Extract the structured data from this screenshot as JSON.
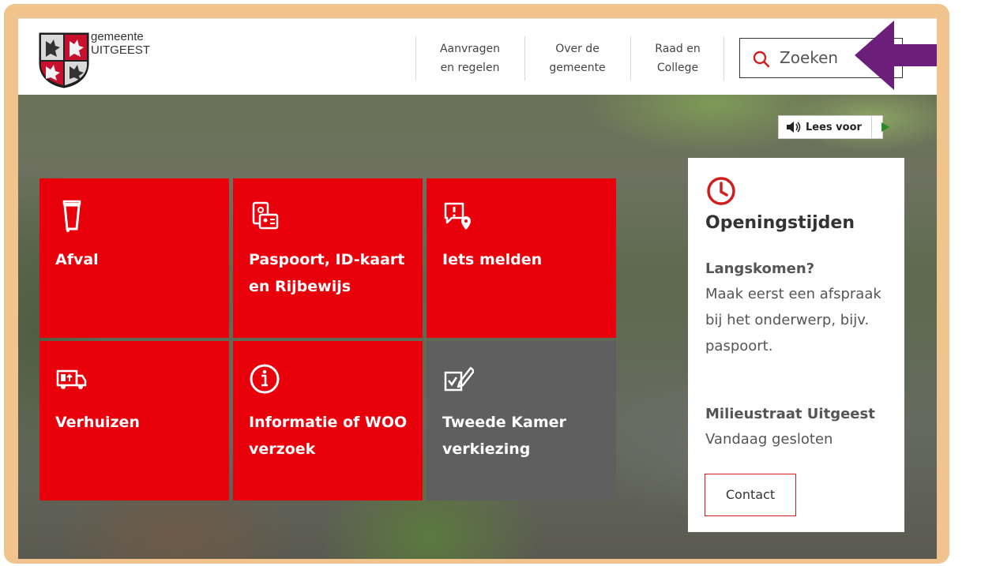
{
  "header": {
    "logo": {
      "line1": "gemeente",
      "line2": "UITGEEST"
    },
    "nav": [
      {
        "line1": "Aanvragen",
        "line2": "en regelen"
      },
      {
        "line1": "Over de",
        "line2": "gemeente"
      },
      {
        "line1": "Raad en",
        "line2": "College"
      }
    ],
    "search": {
      "placeholder": "Zoeken",
      "icon": "search-icon"
    }
  },
  "read_aloud": {
    "label": "Lees voor",
    "icon": "speaker-icon",
    "play_icon": "play-icon"
  },
  "tiles": [
    {
      "title": "Afval",
      "icon": "trash-bin-icon"
    },
    {
      "title": "Paspoort, ID-kaart en Rijbewijs",
      "icon": "id-card-icon"
    },
    {
      "title": "Iets melden",
      "icon": "report-location-icon"
    },
    {
      "title": "Verhuizen",
      "icon": "moving-truck-icon"
    },
    {
      "title": "Informatie of WOO verzoek",
      "icon": "info-icon"
    },
    {
      "title": "Tweede Kamer verkiezing",
      "icon": "ballot-vote-icon"
    }
  ],
  "opening_hours": {
    "icon": "clock-icon",
    "title": "Openingstijden",
    "visit_heading": "Langskomen?",
    "visit_text": "Maak eerst een afspraak bij het onderwerp, bijv. paspoort.",
    "depot_heading": "Milieustraat Uitgeest",
    "depot_status": "Vandaag gesloten",
    "contact_label": "Contact"
  },
  "colors": {
    "brand_red": "#e8000b",
    "tile_gray": "#5f5f5f",
    "frame": "#f1c48e",
    "arrow": "#6b1f7a"
  }
}
